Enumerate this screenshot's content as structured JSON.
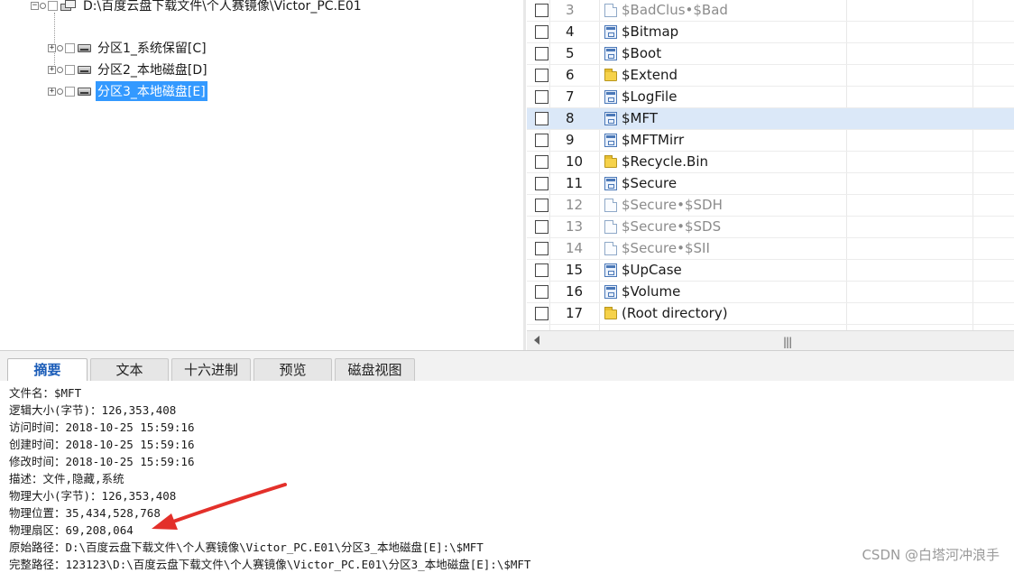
{
  "tree": {
    "root_label": "D:\\百度云盘下载文件\\个人赛镜像\\Victor_PC.E01",
    "partitions": [
      {
        "label": "分区1_系统保留[C]",
        "selected": false
      },
      {
        "label": "分区2_本地磁盘[D]",
        "selected": false
      },
      {
        "label": "分区3_本地磁盘[E]",
        "selected": true
      }
    ]
  },
  "file_list": {
    "rows": [
      {
        "num": "3",
        "name": "$BadClus•$Bad",
        "icon": "file-icon",
        "dim": true,
        "highlight": false
      },
      {
        "num": "4",
        "name": "$Bitmap",
        "icon": "system-file-icon",
        "dim": false,
        "highlight": false
      },
      {
        "num": "5",
        "name": "$Boot",
        "icon": "system-file-icon",
        "dim": false,
        "highlight": false
      },
      {
        "num": "6",
        "name": "$Extend",
        "icon": "folder-icon",
        "dim": false,
        "highlight": false
      },
      {
        "num": "7",
        "name": "$LogFile",
        "icon": "system-file-icon",
        "dim": false,
        "highlight": false
      },
      {
        "num": "8",
        "name": "$MFT",
        "icon": "system-file-icon",
        "dim": false,
        "highlight": true
      },
      {
        "num": "9",
        "name": "$MFTMirr",
        "icon": "system-file-icon",
        "dim": false,
        "highlight": false
      },
      {
        "num": "10",
        "name": "$Recycle.Bin",
        "icon": "folder-icon",
        "dim": false,
        "highlight": false
      },
      {
        "num": "11",
        "name": "$Secure",
        "icon": "system-file-icon",
        "dim": false,
        "highlight": false
      },
      {
        "num": "12",
        "name": "$Secure•$SDH",
        "icon": "file-icon",
        "dim": true,
        "highlight": false
      },
      {
        "num": "13",
        "name": "$Secure•$SDS",
        "icon": "file-icon",
        "dim": true,
        "highlight": false
      },
      {
        "num": "14",
        "name": "$Secure•$SII",
        "icon": "file-icon",
        "dim": true,
        "highlight": false
      },
      {
        "num": "15",
        "name": "$UpCase",
        "icon": "system-file-icon",
        "dim": false,
        "highlight": false
      },
      {
        "num": "16",
        "name": "$Volume",
        "icon": "system-file-icon",
        "dim": false,
        "highlight": false
      },
      {
        "num": "17",
        "name": "(Root directory)",
        "icon": "folder-icon",
        "dim": false,
        "highlight": false
      }
    ]
  },
  "tabs": [
    {
      "label": "摘要",
      "active": true
    },
    {
      "label": "文本",
      "active": false
    },
    {
      "label": "十六进制",
      "active": false
    },
    {
      "label": "预览",
      "active": false
    },
    {
      "label": "磁盘视图",
      "active": false
    }
  ],
  "summary": {
    "lines": [
      "文件名：$MFT",
      "逻辑大小(字节)：126,353,408",
      "访问时间：2018-10-25 15:59:16",
      "创建时间：2018-10-25 15:59:16",
      "修改时间：2018-10-25 15:59:16",
      "描述：文件,隐藏,系统",
      "物理大小(字节)：126,353,408",
      "物理位置：35,434,528,768",
      "物理扇区：69,208,064",
      "原始路径：D:\\百度云盘下载文件\\个人赛镜像\\Victor_PC.E01\\分区3_本地磁盘[E]:\\$MFT",
      "完整路径：123123\\D:\\百度云盘下载文件\\个人赛镜像\\Victor_PC.E01\\分区3_本地磁盘[E]:\\$MFT"
    ]
  },
  "watermark": "CSDN @白塔河冲浪手",
  "colors": {
    "selection": "#3399ff",
    "row_highlight": "#dbe8f8",
    "active_tab_text": "#1a5cb8",
    "annotation_arrow": "#e3302a"
  }
}
